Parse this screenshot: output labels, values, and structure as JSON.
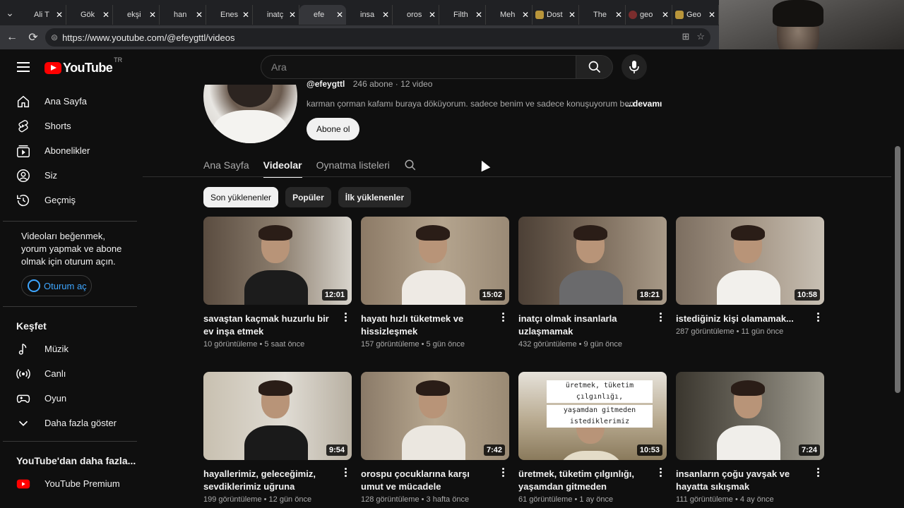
{
  "browser": {
    "tabs": [
      {
        "label": "Ali T",
        "fav": "yt"
      },
      {
        "label": "Gök",
        "fav": "yt"
      },
      {
        "label": "ekşi",
        "fav": "yt"
      },
      {
        "label": "han",
        "fav": "yt"
      },
      {
        "label": "Enes",
        "fav": "yt"
      },
      {
        "label": "inatç",
        "fav": "yt"
      },
      {
        "label": "efe",
        "fav": "yt",
        "active": true
      },
      {
        "label": "insa",
        "fav": "yt"
      },
      {
        "label": "oros",
        "fav": "yt"
      },
      {
        "label": "Filth",
        "fav": "yt"
      },
      {
        "label": "Meh",
        "fav": "yt"
      },
      {
        "label": "Dost",
        "fav": "gold"
      },
      {
        "label": "The",
        "fav": "yt"
      },
      {
        "label": "geo",
        "fav": "y"
      },
      {
        "label": "Geo",
        "fav": "gold"
      }
    ],
    "url": "https://www.youtube.com/@efeygttl/videos"
  },
  "youtube": {
    "logo_text": "YouTube",
    "country_code": "TR",
    "search_placeholder": "Ara"
  },
  "sidebar": {
    "main": [
      {
        "label": "Ana Sayfa",
        "icon": "home-icon"
      },
      {
        "label": "Shorts",
        "icon": "shorts-icon"
      },
      {
        "label": "Abonelikler",
        "icon": "subscriptions-icon"
      },
      {
        "label": "Siz",
        "icon": "user-icon"
      },
      {
        "label": "Geçmiş",
        "icon": "history-icon"
      }
    ],
    "signin_text": "Videoları beğenmek, yorum yapmak ve abone olmak için oturum açın.",
    "signin_button": "Oturum aç",
    "explore_heading": "Keşfet",
    "explore": [
      {
        "label": "Müzik",
        "icon": "music-icon"
      },
      {
        "label": "Canlı",
        "icon": "live-icon"
      },
      {
        "label": "Oyun",
        "icon": "gaming-icon"
      },
      {
        "label": "Daha fazla göster",
        "icon": "chevron-down-icon"
      }
    ],
    "more_heading": "YouTube'dan daha fazla...",
    "more": [
      {
        "label": "YouTube Premium",
        "icon": "youtube-premium-icon"
      }
    ]
  },
  "channel": {
    "handle": "@efeygttl",
    "stats": "246 abone · 12 video",
    "description": "karman çorman kafamı buraya döküyorum. sadece benim ve sadece konuşuyorum ben",
    "more_label": "...devamı",
    "subscribe_label": "Abone ol",
    "tabs": [
      "Ana Sayfa",
      "Videolar",
      "Oynatma listeleri"
    ],
    "active_tab": "Videolar",
    "chips": [
      "Son yüklenenler",
      "Popüler",
      "İlk yüklenenler"
    ]
  },
  "videos": [
    {
      "title": "savaştan kaçmak huzurlu bir ev inşa etmek",
      "views": "10 görüntüleme",
      "age": "5 saat önce",
      "duration": "12:01"
    },
    {
      "title": "hayatı hızlı tüketmek ve hissizleşmek",
      "views": "157 görüntüleme",
      "age": "5 gün önce",
      "duration": "15:02"
    },
    {
      "title": "inatçı olmak insanlarla uzlaşmamak",
      "views": "432 görüntüleme",
      "age": "9 gün önce",
      "duration": "18:21"
    },
    {
      "title": "istediğiniz kişi olamamak...",
      "views": "287 görüntüleme",
      "age": "11 gün önce",
      "duration": "10:58"
    },
    {
      "title": "hayallerimiz, geleceğimiz, sevdiklerimiz uğruna yorulmak ne...",
      "views": "199 görüntüleme",
      "age": "12 gün önce",
      "duration": "9:54"
    },
    {
      "title": "orospu çocuklarına karşı umut ve mücadele",
      "views": "128 görüntüleme",
      "age": "3 hafta önce",
      "duration": "7:42"
    },
    {
      "title": "üretmek, tüketim çılgınlığı, yaşamdan gitmeden istediklerimiz...",
      "views": "61 görüntüleme",
      "age": "1 ay önce",
      "duration": "10:53",
      "overlay": [
        "üretmek, tüketim çılgınlığı,",
        "yaşamdan gitmeden istediklerimiz"
      ]
    },
    {
      "title": "insanların çoğu yavşak ve hayatta sıkışmak",
      "views": "111 görüntüleme",
      "age": "4 ay önce",
      "duration": "7:24"
    }
  ],
  "colors": {
    "bg": "#0f0f0f",
    "accent_red": "#ff0000",
    "link_blue": "#3ea6ff"
  }
}
